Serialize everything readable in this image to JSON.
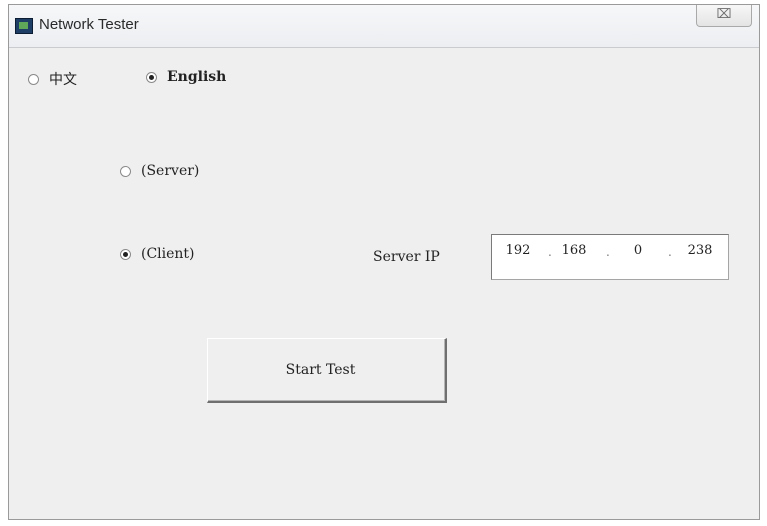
{
  "window": {
    "title": "Network Tester",
    "close_glyph": "⌧"
  },
  "language": {
    "options": [
      {
        "label": "中文",
        "selected": false
      },
      {
        "label": "English",
        "selected": true
      }
    ]
  },
  "mode": {
    "options": [
      {
        "label": "(Server)",
        "selected": false
      },
      {
        "label": "(Client)",
        "selected": true
      }
    ]
  },
  "server_ip": {
    "label": "Server IP",
    "octets": [
      "192",
      "168",
      "0",
      "238"
    ]
  },
  "start_button": {
    "label": "Start Test"
  },
  "icons": {
    "app": "network-app-icon",
    "close": "close-icon"
  }
}
